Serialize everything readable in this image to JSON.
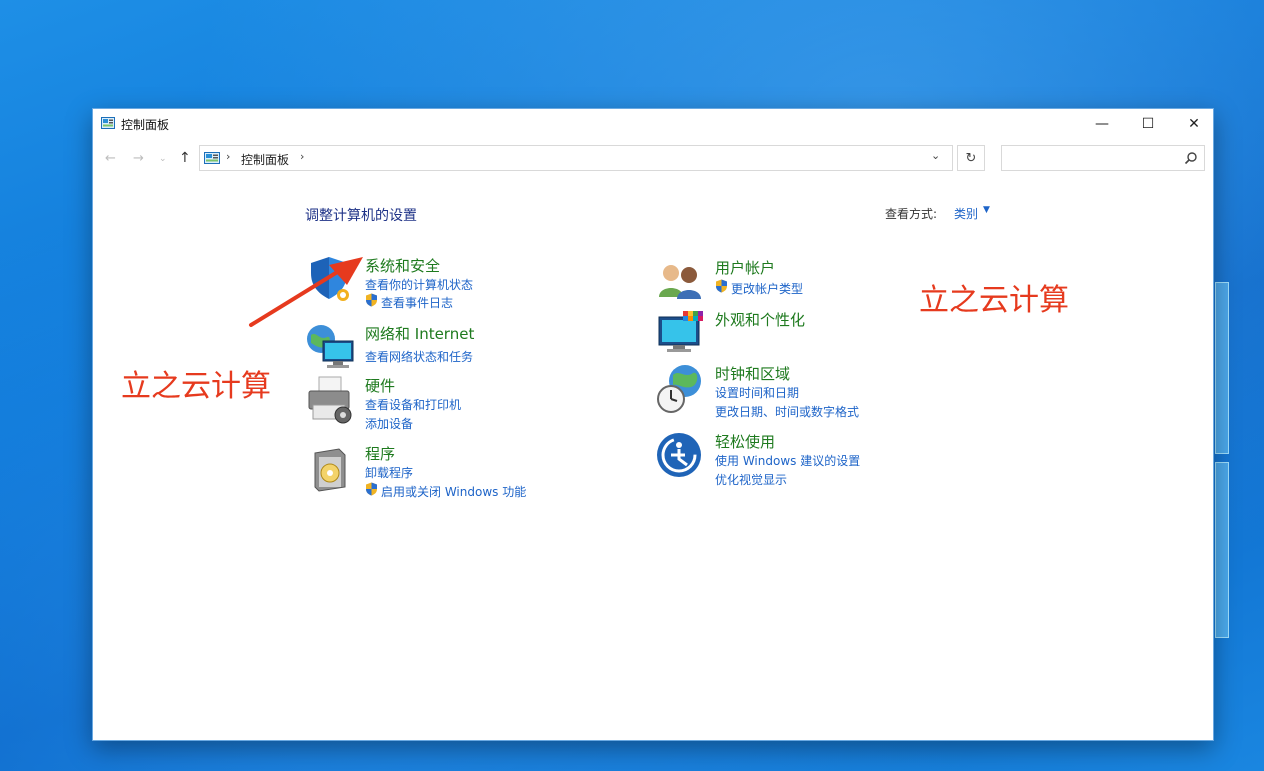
{
  "window": {
    "title": "控制面板",
    "controls": {
      "minimize": "—",
      "maximize": "☐",
      "close": "✕"
    }
  },
  "nav": {
    "back": "←",
    "forward": "→",
    "recent": "⌄",
    "up": "↑",
    "separator": "›",
    "address_text": "控制面板",
    "dropdown": "⌄",
    "refresh": "↻",
    "search_placeholder": ""
  },
  "main": {
    "heading": "调整计算机的设置",
    "view_by_label": "查看方式:",
    "view_by_value": "类别",
    "view_by_caret": "▼"
  },
  "categories": [
    {
      "icon": "shield-icon",
      "title": "系统和安全",
      "links": [
        {
          "text": "查看你的计算机状态",
          "shield": false
        },
        {
          "text": "查看事件日志",
          "shield": true
        }
      ]
    },
    {
      "icon": "network-globe-icon",
      "title": "网络和 Internet",
      "links": [
        {
          "text": "查看网络状态和任务",
          "shield": false
        }
      ]
    },
    {
      "icon": "printer-icon",
      "title": "硬件",
      "links": [
        {
          "text": "查看设备和打印机",
          "shield": false
        },
        {
          "text": "添加设备",
          "shield": false
        }
      ]
    },
    {
      "icon": "programs-disc-icon",
      "title": "程序",
      "links": [
        {
          "text": "卸载程序",
          "shield": false
        },
        {
          "text": "启用或关闭 Windows 功能",
          "shield": true
        }
      ]
    },
    {
      "icon": "users-icon",
      "title": "用户帐户",
      "links": [
        {
          "text": "更改帐户类型",
          "shield": true
        }
      ]
    },
    {
      "icon": "monitor-palette-icon",
      "title": "外观和个性化",
      "links": []
    },
    {
      "icon": "clock-globe-icon",
      "title": "时钟和区域",
      "links": [
        {
          "text": "设置时间和日期",
          "shield": false
        },
        {
          "text": "更改日期、时间或数字格式",
          "shield": false
        }
      ]
    },
    {
      "icon": "ease-of-access-icon",
      "title": "轻松使用",
      "links": [
        {
          "text": "使用 Windows 建议的设置",
          "shield": false
        },
        {
          "text": "优化视觉显示",
          "shield": false
        }
      ]
    }
  ],
  "watermarks": {
    "left": "立之云计算",
    "right": "立之云计算"
  },
  "colors": {
    "title_green": "#1e7a1e",
    "link_blue": "#1e64c8",
    "heading_blue": "#1e3287",
    "watermark_red": "#e63a1e",
    "desktop_blue": "#0f78d8"
  }
}
